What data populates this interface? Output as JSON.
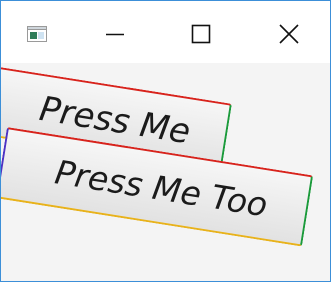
{
  "window": {
    "controls": {
      "minimize_icon": "minimize-icon",
      "maximize_icon": "maximize-icon",
      "close_icon": "close-icon"
    },
    "app_icon": "window-app-icon"
  },
  "buttons": {
    "first_label": "Press Me",
    "second_label": "Press Me Too"
  },
  "colors": {
    "border_top": "#d8231c",
    "border_right": "#1a9a3a",
    "border_bottom": "#e8b21b",
    "border_left": "#4c32c4",
    "window_border": "#3c8fd8"
  }
}
